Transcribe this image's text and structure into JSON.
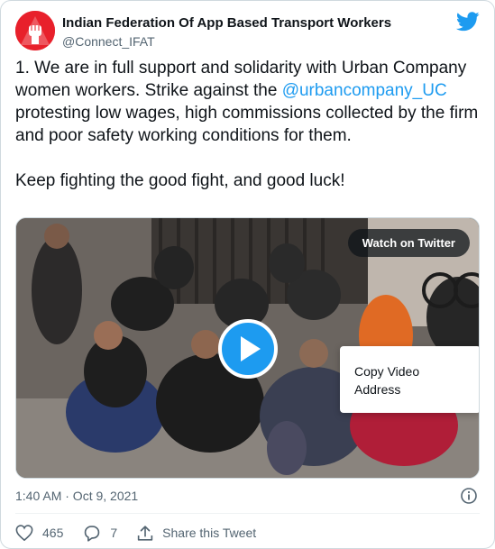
{
  "account": {
    "name": "Indian Federation Of App Based Transport Workers",
    "handle": "@Connect_IFAT"
  },
  "tweet": {
    "line1_pre": "1. We are in full support and solidarity with Urban Company women workers. Strike against the ",
    "mention": "@urbancompany_UC",
    "line1_post": " protesting low wages, high commissions collected by the firm and poor safety working conditions for them.",
    "line2": "Keep fighting the good fight, and good luck!"
  },
  "media": {
    "watch_label": "Watch on Twitter",
    "context_menu_item": "Copy Video Address"
  },
  "meta": {
    "timestamp": "1:40 AM · Oct 9, 2021"
  },
  "actions": {
    "likes": "465",
    "replies": "7",
    "share_label": "Share this Tweet"
  },
  "colors": {
    "brand_blue": "#1d9bf0",
    "avatar_red": "#e8202b"
  },
  "icons": [
    "fist-logo",
    "twitter-bird-icon",
    "play-icon",
    "info-icon",
    "heart-icon",
    "reply-icon",
    "share-icon"
  ]
}
